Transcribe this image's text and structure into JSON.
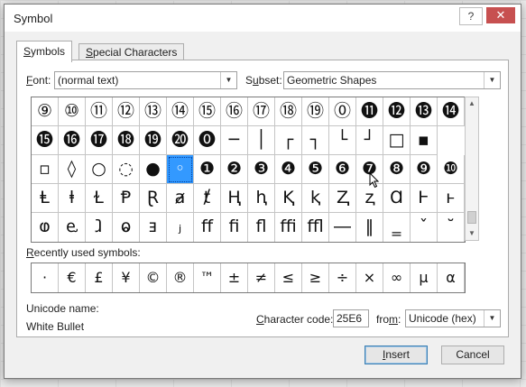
{
  "window": {
    "title": "Symbol",
    "help_label": "?",
    "close_label": "✕"
  },
  "tabs": [
    {
      "label_u": "S",
      "label_rest": "ymbols"
    },
    {
      "label_u": "S",
      "label_rest": "pecial Characters"
    }
  ],
  "font": {
    "label_u": "F",
    "label_rest": "ont:",
    "value": "(normal text)"
  },
  "subset": {
    "label_u": "u",
    "label_pre": "S",
    "label_rest": "bset:",
    "value": "Geometric Shapes"
  },
  "symbol_grid": [
    [
      "⑨",
      "⑩",
      "⑪",
      "⑫",
      "⑬",
      "⑭",
      "⑮",
      "⑯",
      "⑰",
      "⑱",
      "⑲",
      "⓪",
      "⓫",
      "⓬",
      "⓭",
      "⓮"
    ],
    [
      "⓯",
      "⓰",
      "⓱",
      "⓲",
      "⓳",
      "⓴",
      "⓿",
      "─",
      "│",
      "┌",
      "┐",
      "└",
      "┘",
      "□",
      "▪"
    ],
    [
      "▫",
      "◊",
      "○",
      "◌",
      "●",
      "◦",
      "❶",
      "❷",
      "❸",
      "❹",
      "❺",
      "❻",
      "❼",
      "❽",
      "❾",
      "❿"
    ],
    [
      "Ⱡ",
      "ⱡ",
      "Ɫ",
      "Ᵽ",
      "Ɽ",
      "ⱥ",
      "ⱦ",
      "Ⱨ",
      "ⱨ",
      "Ⱪ",
      "ⱪ",
      "Ⱬ",
      "ⱬ",
      "Ɑ",
      "Ⱶ",
      "ⱶ"
    ],
    [
      "ⱷ",
      "ⱸ",
      "ⱹ",
      "ⱺ",
      "ⱻ",
      "ⱼ",
      "ﬀ",
      "ﬁ",
      "ﬂ",
      "ﬃ",
      "ﬄ",
      "―",
      "‖",
      "‗",
      "ˇ",
      "˘"
    ]
  ],
  "selected": {
    "row": 2,
    "col": 5
  },
  "recent_label_u": "R",
  "recent_label_rest": "ecently used symbols:",
  "recent_symbols": [
    "·",
    "€",
    "£",
    "¥",
    "©",
    "®",
    "™",
    "±",
    "≠",
    "≤",
    "≥",
    "÷",
    "×",
    "∞",
    "µ",
    "α"
  ],
  "unicode_name_label": "Unicode name:",
  "unicode_name_value": "White Bullet",
  "character_code": {
    "label_u": "C",
    "label_rest": "haracter code:",
    "value": "25E6"
  },
  "from": {
    "label_pre": "fro",
    "label_u": "m",
    "label_rest": ":",
    "value": "Unicode (hex)"
  },
  "buttons": {
    "insert_u": "I",
    "insert_rest": "nsert",
    "cancel": "Cancel"
  }
}
